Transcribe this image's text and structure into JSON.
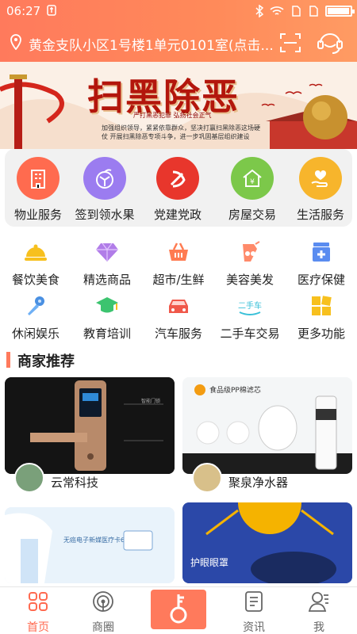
{
  "status_bar": {
    "time": "06:27",
    "battery_level": 0.95
  },
  "header": {
    "address": "黄金支队小区1号楼1单元0101室(点击...",
    "icons": [
      "location-pin-icon",
      "scan-icon",
      "customer-service-icon"
    ]
  },
  "banner": {
    "title": "扫黑除恶",
    "subtitle": "严打黑恶犯罪  弘扬社会正气",
    "body": "加强组织领导，紧紧依靠群众，坚决打赢扫黑除恶这场硬仗 开展扫黑除恶专项斗争，进一步巩固基层组织建设"
  },
  "primary_services": [
    {
      "label": "物业服务",
      "icon": "building-icon",
      "color": "#ff6b4f"
    },
    {
      "label": "签到领水果",
      "icon": "orange-icon",
      "color": "#9b7cf0"
    },
    {
      "label": "党建党政",
      "icon": "party-emblem-icon",
      "color": "#e8362c"
    },
    {
      "label": "房屋交易",
      "icon": "house-money-icon",
      "color": "#7cc84a"
    },
    {
      "label": "生活服务",
      "icon": "heart-hand-icon",
      "color": "#f7b52c"
    }
  ],
  "secondary_services": [
    {
      "label": "餐饮美食",
      "icon": "dish-cover-icon"
    },
    {
      "label": "精选商品",
      "icon": "diamond-icon"
    },
    {
      "label": "超市/生鲜",
      "icon": "basket-icon"
    },
    {
      "label": "美容美发",
      "icon": "scissors-icon"
    },
    {
      "label": "医疗保健",
      "icon": "medical-kit-icon"
    },
    {
      "label": "休闲娱乐",
      "icon": "microphone-icon"
    },
    {
      "label": "教育培训",
      "icon": "graduation-cap-icon"
    },
    {
      "label": "汽车服务",
      "icon": "car-icon"
    },
    {
      "label": "二手车交易",
      "icon": "used-car-icon",
      "badge": "二手车"
    },
    {
      "label": "更多功能",
      "icon": "grid-icon"
    }
  ],
  "section": {
    "title": "商家推荐"
  },
  "merchants": [
    {
      "name": "云常科技",
      "image_text": "智能门锁"
    },
    {
      "name": "聚泉净水器",
      "image_text": "食品级PP棉滤芯"
    },
    {
      "name": "",
      "image_text": "无癌电子新媒医疗卡600"
    },
    {
      "name": "",
      "image_text": "护眼眼罩"
    }
  ],
  "bottom_nav": [
    {
      "label": "首页",
      "icon": "home-grid-icon",
      "active": true
    },
    {
      "label": "商圈",
      "icon": "radar-icon",
      "active": false
    },
    {
      "label": "",
      "icon": "key-icon",
      "active": false
    },
    {
      "label": "资讯",
      "icon": "document-icon",
      "active": false
    },
    {
      "label": "我",
      "icon": "user-icon",
      "active": false
    }
  ]
}
